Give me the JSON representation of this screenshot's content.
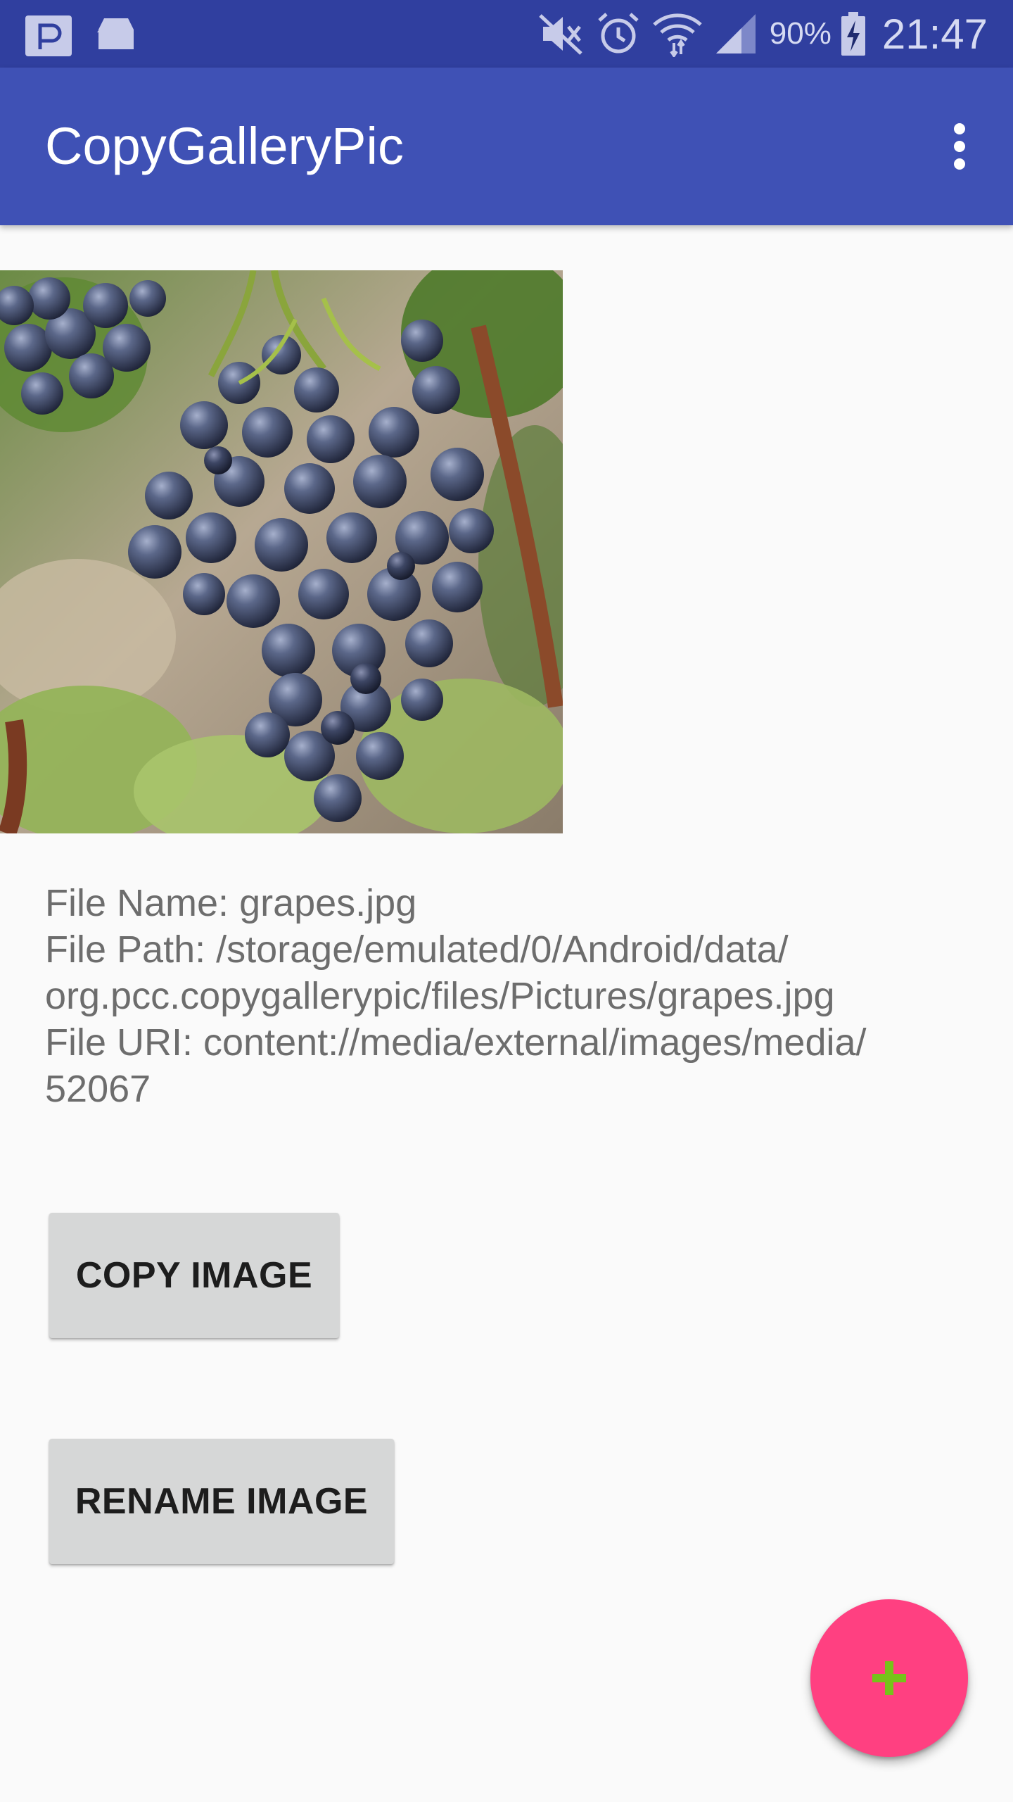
{
  "status_bar": {
    "left_icons": [
      "notification-p-icon",
      "home-app-icon"
    ],
    "right_icons": [
      "mute-icon",
      "alarm-icon",
      "wifi-icon",
      "signal-icon",
      "battery-charging-icon"
    ],
    "battery_percent": "90%",
    "time": "21:47"
  },
  "app_bar": {
    "title": "CopyGalleryPic",
    "menu_icon": "overflow-menu-icon"
  },
  "image": {
    "subject": "grapes photo"
  },
  "file_info": {
    "name_line": "File Name: grapes.jpg",
    "path_line_1": "File Path: /storage/emulated/0/Android/data/",
    "path_line_2": "org.pcc.copygallerypic/files/Pictures/grapes.jpg",
    "uri_line_1": "File URI: content://media/external/images/media/",
    "uri_line_2": "52067"
  },
  "buttons": {
    "copy_label": "COPY IMAGE",
    "rename_label": "RENAME IMAGE"
  },
  "fab": {
    "icon": "plus-icon"
  },
  "colors": {
    "status_bar": "#303f9f",
    "app_bar": "#3f51b5",
    "fab": "#ff4081",
    "fab_icon": "#76c31a",
    "background": "#fafafa"
  }
}
